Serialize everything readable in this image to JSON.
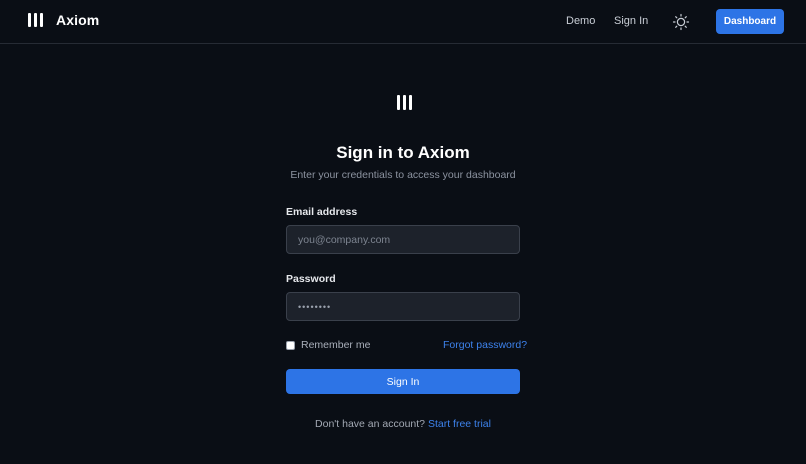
{
  "header": {
    "brand": "Axiom",
    "nav": {
      "demo": "Demo",
      "sign_in": "Sign In"
    },
    "theme_icon": "sun-icon",
    "dashboard_label": "Dashboard"
  },
  "login": {
    "logo_icon": "axiom-logo-icon",
    "title": "Sign in to Axiom",
    "subtitle": "Enter your credentials to access your dashboard",
    "email": {
      "label": "Email address",
      "placeholder": "you@company.com",
      "value": ""
    },
    "password": {
      "label": "Password",
      "value": "••••••••"
    },
    "remember_label": "Remember me",
    "remember_checked": false,
    "forgot_label": "Forgot password?",
    "submit_label": "Sign In",
    "signup_prompt": "Don't have an account?",
    "signup_link": "Start free trial"
  },
  "colors": {
    "background": "#0a0e15",
    "accent": "#2d74e6",
    "link": "#3d82ec",
    "input_bg": "#1d222b"
  }
}
